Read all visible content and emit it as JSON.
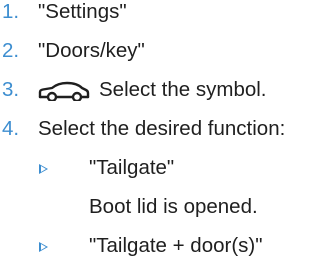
{
  "steps": [
    {
      "number": "1.",
      "text": "\"Settings\""
    },
    {
      "number": "2.",
      "text": "\"Doors/key\""
    },
    {
      "number": "3.",
      "icon": "car-outline-icon",
      "text": "Select the symbol."
    },
    {
      "number": "4.",
      "text": "Select the desired function:"
    }
  ],
  "options": [
    {
      "bullet_icon": "triangle-bullet-icon",
      "label": "\"Tailgate\"",
      "description": "Boot lid is opened."
    },
    {
      "bullet_icon": "triangle-bullet-icon",
      "label": "\"Tailgate + door(s)\""
    }
  ],
  "colors": {
    "accent": "#3d8ed0",
    "text": "#1f1f1f"
  }
}
